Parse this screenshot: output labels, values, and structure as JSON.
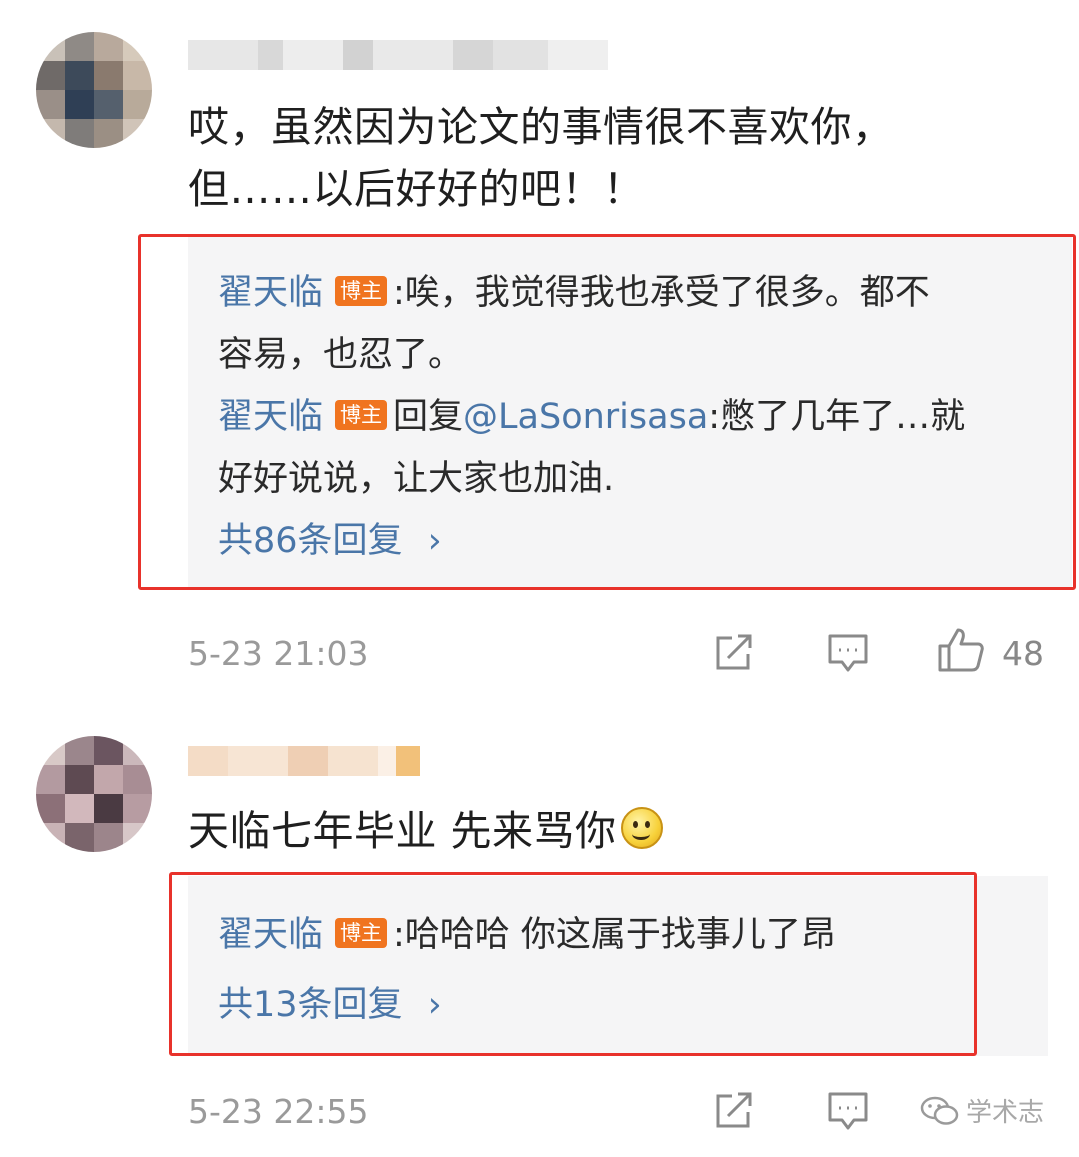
{
  "comments": [
    {
      "text_lines": [
        "哎，虽然因为论文的事情很不喜欢你，",
        "但……以后好好的吧！！"
      ],
      "replies": [
        {
          "author": "翟天临",
          "badge": "博主",
          "text": ":唉，我觉得我也承受了很多。都不",
          "text2": "容易，也忍了。"
        },
        {
          "author": "翟天临",
          "badge": "博主",
          "prefix": "回复",
          "mention": "@LaSonrisasa",
          "text": ":憋了几年了…就",
          "text2": "好好说说，让大家也加油."
        }
      ],
      "more_replies": "共86条回复",
      "time": "5-23 21:03",
      "likes": "48"
    },
    {
      "text_lines": [
        "天临七年毕业 先来骂你"
      ],
      "emoji": "smile-emoji",
      "replies": [
        {
          "author": "翟天临",
          "badge": "博主",
          "text": ":哈哈哈 你这属于找事儿了昂"
        }
      ],
      "more_replies": "共13条回复",
      "time": "5-23 22:55"
    }
  ],
  "chevron": "›",
  "watermark": "学术志",
  "colors": {
    "link": "#4a76a8",
    "badge": "#f0741f",
    "highlight_box": "#e8322b"
  },
  "icons": [
    "share-icon",
    "comment-icon",
    "like-icon",
    "wechat-icon"
  ]
}
